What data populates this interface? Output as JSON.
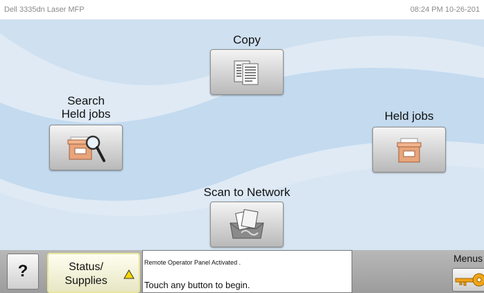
{
  "header": {
    "model": "Dell 3335dn Laser MFP",
    "datetime": "08:24 PM 10-26-201"
  },
  "home": {
    "copy_label": "Copy",
    "search_held_label_line1": "Search",
    "search_held_label_line2": "Held jobs",
    "held_jobs_label": "Held jobs",
    "scan_label": "Scan to Network"
  },
  "bottom": {
    "help_label": "?",
    "status_line1": "Status/",
    "status_line2": "Supplies",
    "message_line1": "Remote Operator Panel Activated .",
    "message_line2": "Touch any button to begin.",
    "menus_label": "Menus"
  },
  "colors": {
    "background": "#dfeaf5",
    "swoosh": "#b9d4ec",
    "status_border": "#e8e59a",
    "warning": "#f5d800",
    "key": "#f0a418"
  },
  "icons": [
    "copy-icon",
    "search-held-jobs-icon",
    "held-jobs-icon",
    "scan-to-network-icon",
    "warning-icon",
    "key-icon"
  ]
}
